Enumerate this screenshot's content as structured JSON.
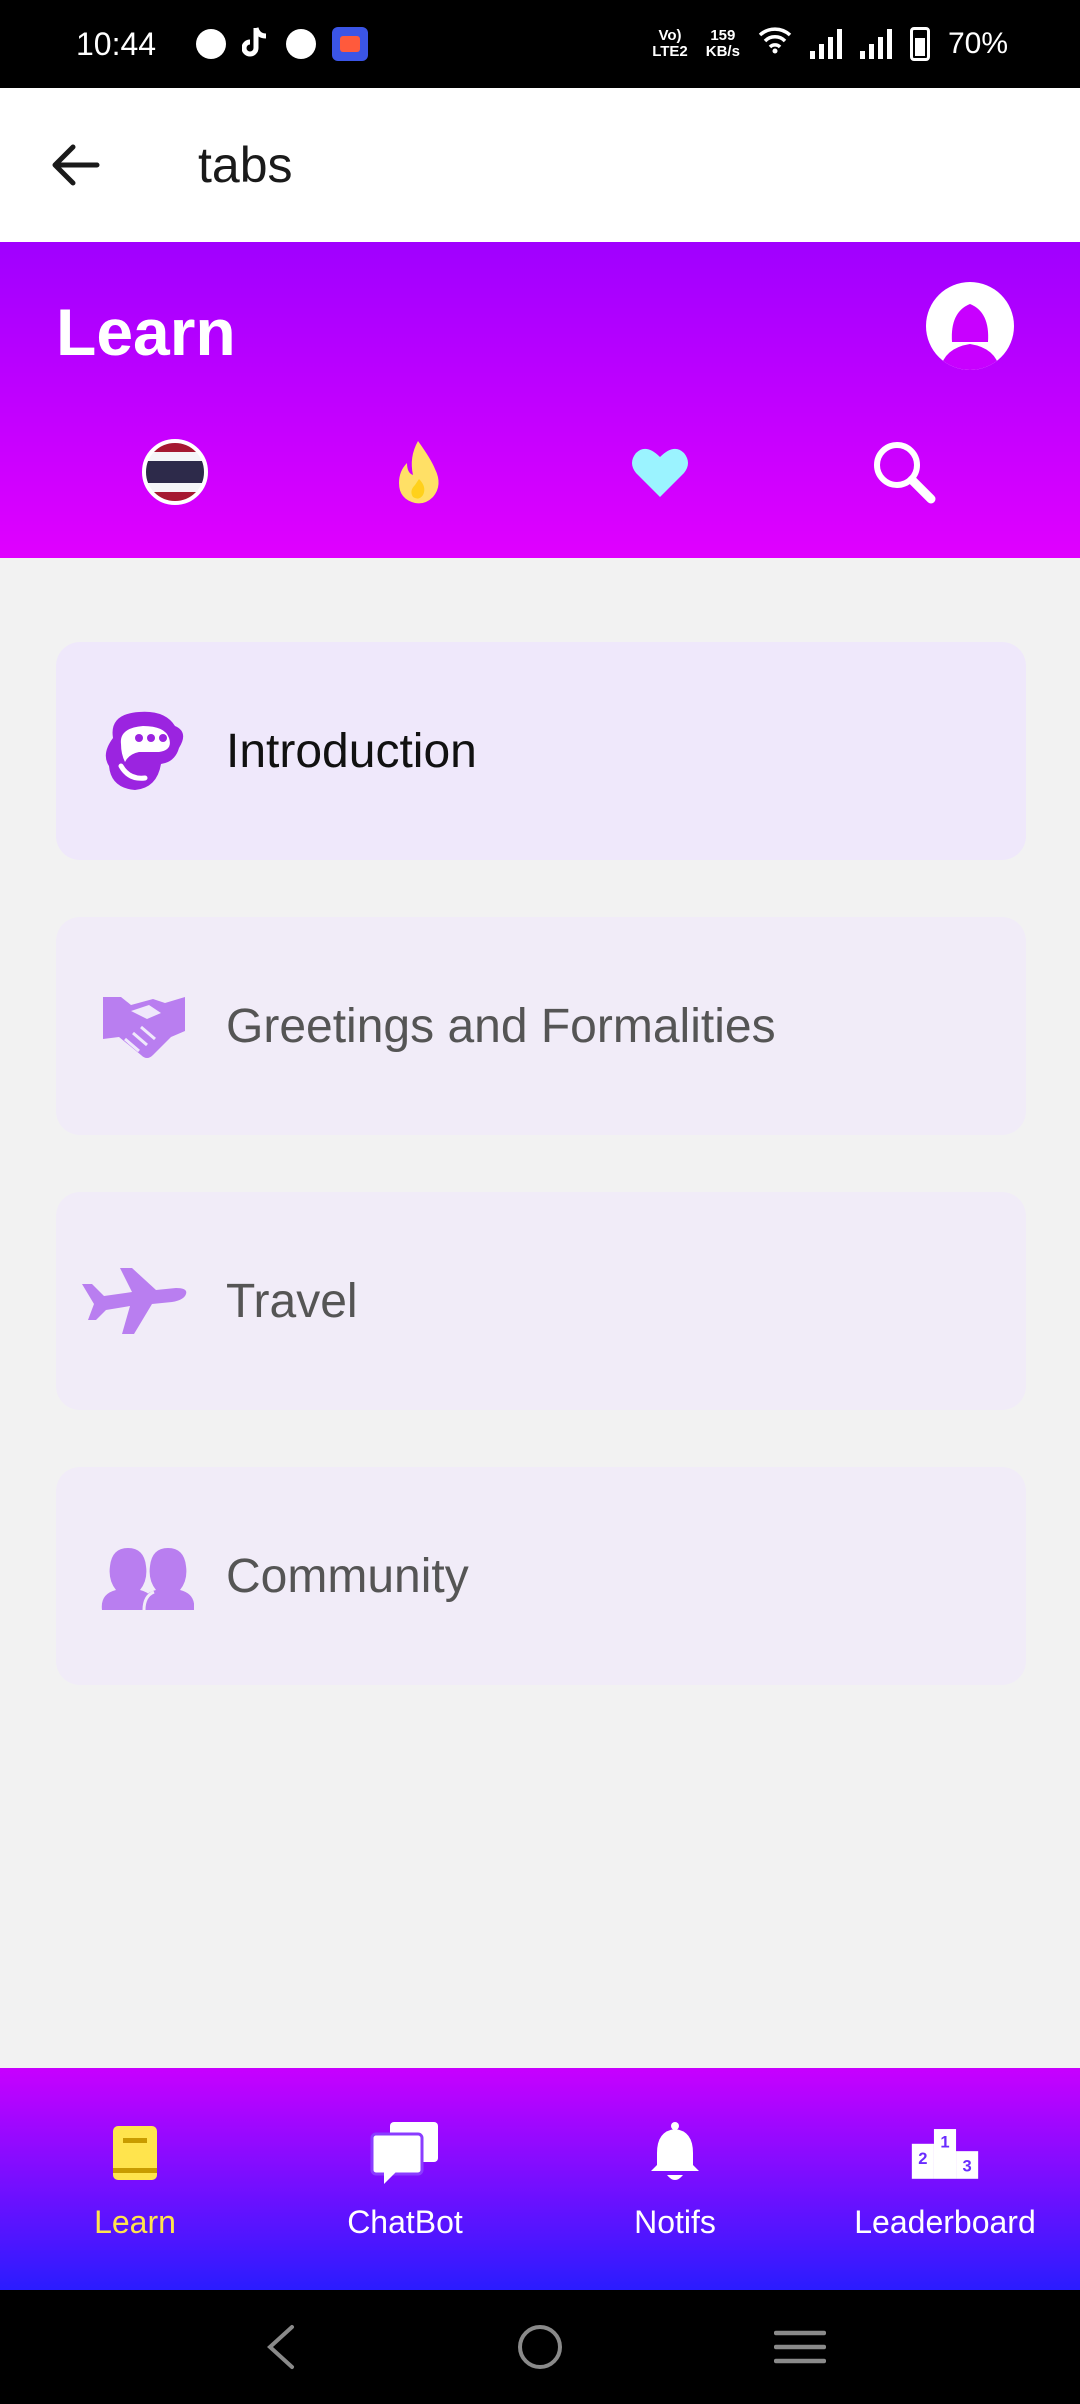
{
  "status_bar": {
    "time": "10:44",
    "network_top": "Vo)",
    "network_bottom": "LTE2",
    "speed_top": "159",
    "speed_bottom": "KB/s",
    "battery": "70%"
  },
  "app_bar": {
    "title": "tabs",
    "back_icon": "arrow-left-icon"
  },
  "header": {
    "title": "Learn",
    "avatar_icon": "user-female-icon",
    "icons": [
      "thai-flag-icon",
      "fire-icon",
      "heart-icon",
      "search-icon"
    ],
    "colors": {
      "gradient_top": "#a000ff",
      "gradient_bottom": "#e000ff"
    }
  },
  "lessons": [
    {
      "label": "Introduction",
      "icon": "chat-head-icon"
    },
    {
      "label": "Greetings and Formalities",
      "icon": "handshake-icon"
    },
    {
      "label": "Travel",
      "icon": "airplane-icon"
    },
    {
      "label": "Community",
      "icon": "people-icon"
    }
  ],
  "bottom_nav": {
    "items": [
      {
        "label": "Learn",
        "icon": "book-icon",
        "active": true
      },
      {
        "label": "ChatBot",
        "icon": "chat-bubbles-icon",
        "active": false
      },
      {
        "label": "Notifs",
        "icon": "bell-icon",
        "active": false
      },
      {
        "label": "Leaderboard",
        "icon": "podium-icon",
        "active": false
      }
    ],
    "colors": {
      "active": "#ffe44d",
      "gradient_top": "#c800ff",
      "gradient_bottom": "#2a1cff"
    }
  },
  "system_nav": [
    "back-icon",
    "home-icon",
    "recents-icon"
  ]
}
